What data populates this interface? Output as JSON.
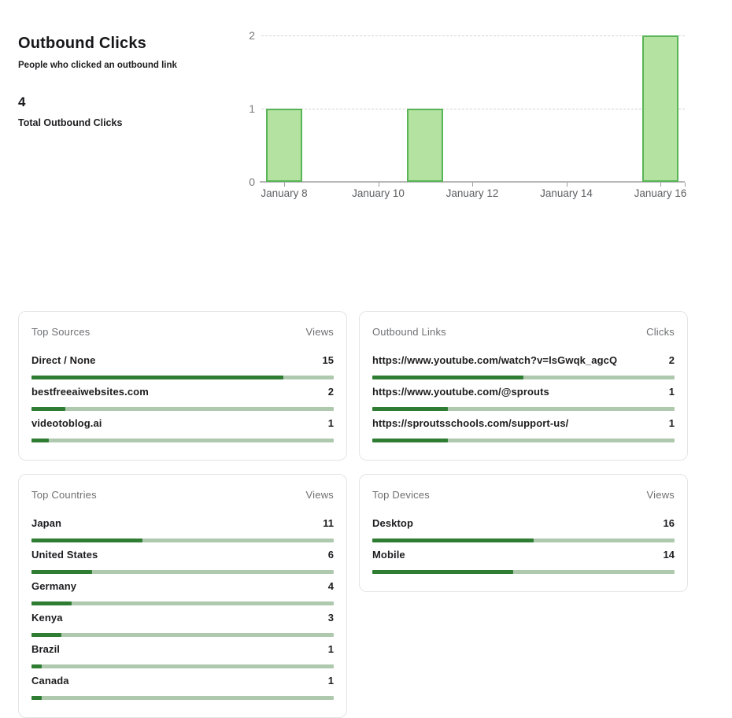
{
  "page": {
    "title": "Outbound Clicks",
    "subtitle": "People who clicked an outbound link",
    "total_value": "4",
    "total_label": "Total Outbound Clicks"
  },
  "chart_data": {
    "type": "bar",
    "bars": [
      {
        "label": "January 8",
        "day": 8,
        "value": 1
      },
      {
        "label": "January 11",
        "day": 11,
        "value": 1
      },
      {
        "label": "January 16",
        "day": 16,
        "value": 2
      }
    ],
    "x_axis": {
      "tick_days": [
        8,
        10,
        12,
        14,
        16
      ],
      "tick_labels": [
        "January 8",
        "January 10",
        "January 12",
        "January 14",
        "January 16"
      ]
    },
    "y_axis": {
      "ticks": [
        0,
        1,
        2
      ],
      "range": [
        0,
        2
      ]
    },
    "grid": "horizontal-dashed",
    "legend": "none",
    "bar_fill_color": "#b3e2a1",
    "bar_border_color": "#58b457"
  },
  "panels": [
    {
      "id": "top-sources",
      "title": "Top Sources",
      "metric_label": "Views",
      "rows": [
        {
          "label": "Direct / None",
          "value": "15",
          "percent": 83.3
        },
        {
          "label": "bestfreeaiwebsites.com",
          "value": "2",
          "percent": 11.1
        },
        {
          "label": "videotoblog.ai",
          "value": "1",
          "percent": 5.6
        }
      ]
    },
    {
      "id": "outbound-links",
      "title": "Outbound Links",
      "metric_label": "Clicks",
      "rows": [
        {
          "label": "https://www.youtube.com/watch?v=lsGwqk_agcQ",
          "value": "2",
          "percent": 50
        },
        {
          "label": "https://www.youtube.com/@sprouts",
          "value": "1",
          "percent": 25
        },
        {
          "label": "https://sproutsschools.com/support-us/",
          "value": "1",
          "percent": 25
        }
      ]
    },
    {
      "id": "top-countries",
      "title": "Top Countries",
      "metric_label": "Views",
      "rows": [
        {
          "label": "Japan",
          "value": "11",
          "percent": 36.7
        },
        {
          "label": "United States",
          "value": "6",
          "percent": 20
        },
        {
          "label": "Germany",
          "value": "4",
          "percent": 13.3
        },
        {
          "label": "Kenya",
          "value": "3",
          "percent": 10
        },
        {
          "label": "Brazil",
          "value": "1",
          "percent": 3.3
        },
        {
          "label": "Canada",
          "value": "1",
          "percent": 3.3
        }
      ]
    },
    {
      "id": "top-devices",
      "title": "Top Devices",
      "metric_label": "Views",
      "rows": [
        {
          "label": "Desktop",
          "value": "16",
          "percent": 53.3
        },
        {
          "label": "Mobile",
          "value": "14",
          "percent": 46.7
        }
      ]
    }
  ],
  "colors": {
    "progress_fill": "#2f7d33",
    "progress_track": "#aec9ae",
    "chart_bar_fill": "#b3e2a1",
    "chart_bar_border": "#58b457",
    "muted_text": "#6e6f72",
    "dark_text": "#1d1d20"
  }
}
